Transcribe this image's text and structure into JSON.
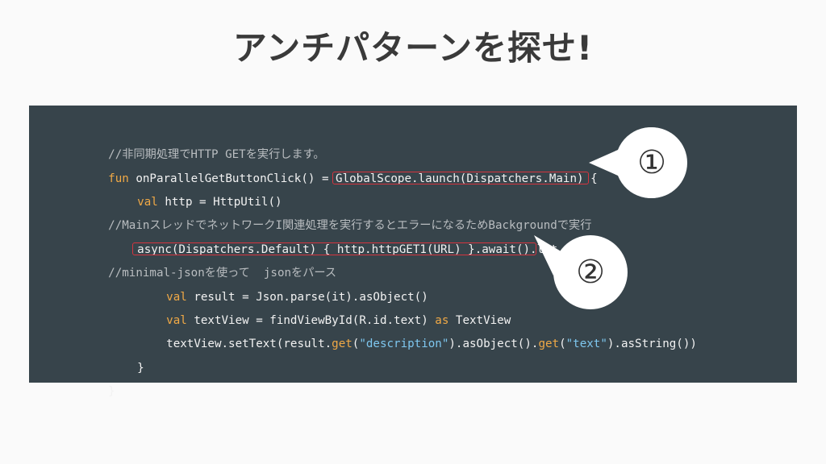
{
  "slide": {
    "title": "アンチパターンを探せ!"
  },
  "code": {
    "line1_comment": "//非同期処理でHTTP GETを実行します。",
    "line2_kw": "fun",
    "line2_a": " onParallelGetButtonClick() = ",
    "line2_b": "GlobalScope.launch(Dispatchers.Main)",
    "line2_c": " {",
    "line3_kw": "val",
    "line3_rest": " http = HttpUtil()",
    "line4_comment": "//MainスレッドでネットワークI関連処理を実行するとエラーになるためBackgroundで実行",
    "line5_a": "async(Dispatchers.Default) { http.httpGET1(URL) }.await()",
    "line5_b": ".let {",
    "line6_comment": "//minimal-jsonを使って  jsonをパース",
    "line7_kw": "val",
    "line7_rest": " result = Json.parse(it).asObject()",
    "line8_kw": "val",
    "line8_a": " textView = findViewById(R.id.text) ",
    "line8_kw2": "as",
    "line8_b": " TextView",
    "line9_a": "textView.setText(result.",
    "line9_get1": "get",
    "line9_b": "(",
    "line9_str1": "\"description\"",
    "line9_c": ").asObject().",
    "line9_get2": "get",
    "line9_d": "(",
    "line9_str2": "\"text\"",
    "line9_e": ").asString())",
    "line10": "}",
    "line11": "}"
  },
  "callouts": {
    "one": "①",
    "two": "②"
  },
  "colors": {
    "code_bg": "#37444b",
    "keyword": "#f0a946",
    "string": "#7ec7ef",
    "comment": "#b9bdc0",
    "highlight": "#d6343f"
  }
}
